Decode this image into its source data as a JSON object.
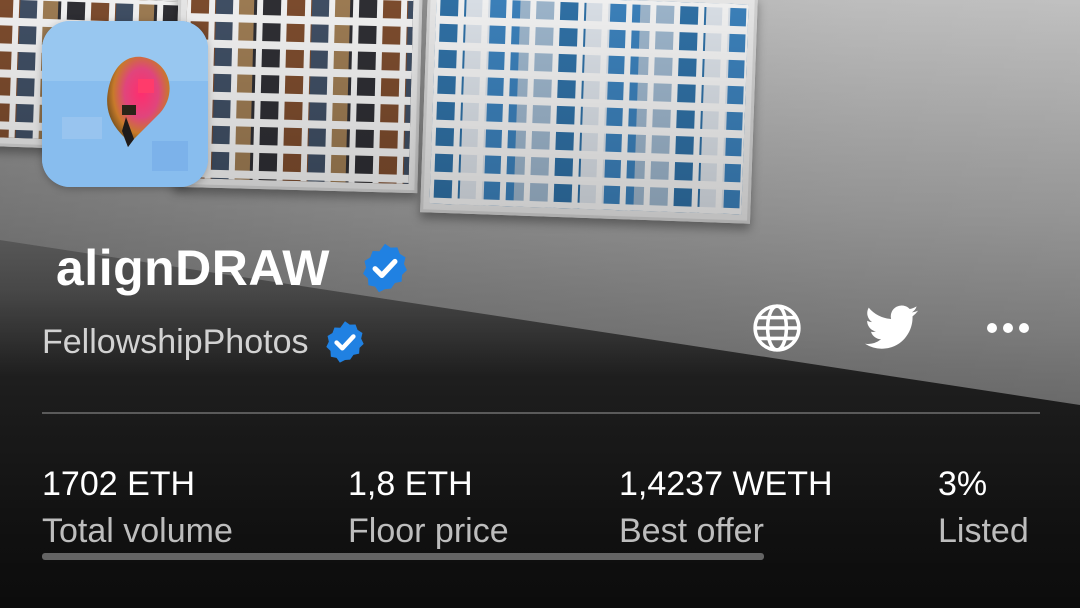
{
  "collection": {
    "name": "alignDRAW",
    "verified": true,
    "creator": "FellowshipPhotos",
    "creator_verified": true
  },
  "icons": {
    "avatar": "collection-avatar-image",
    "verified": "verified-badge-icon",
    "globe": "globe-icon",
    "twitter": "twitter-icon",
    "more": "more-icon"
  },
  "colors": {
    "verified_badge": "#2081e2",
    "background": "#1c1c1c",
    "text_primary": "#ffffff",
    "text_secondary": "#bdbdbd"
  },
  "stats": [
    {
      "value": "1702 ETH",
      "label": "Total volume"
    },
    {
      "value": "1,8 ETH",
      "label": "Floor price"
    },
    {
      "value": "1,4237 WETH",
      "label": "Best offer"
    },
    {
      "value": "3%",
      "label": "Listed"
    }
  ]
}
